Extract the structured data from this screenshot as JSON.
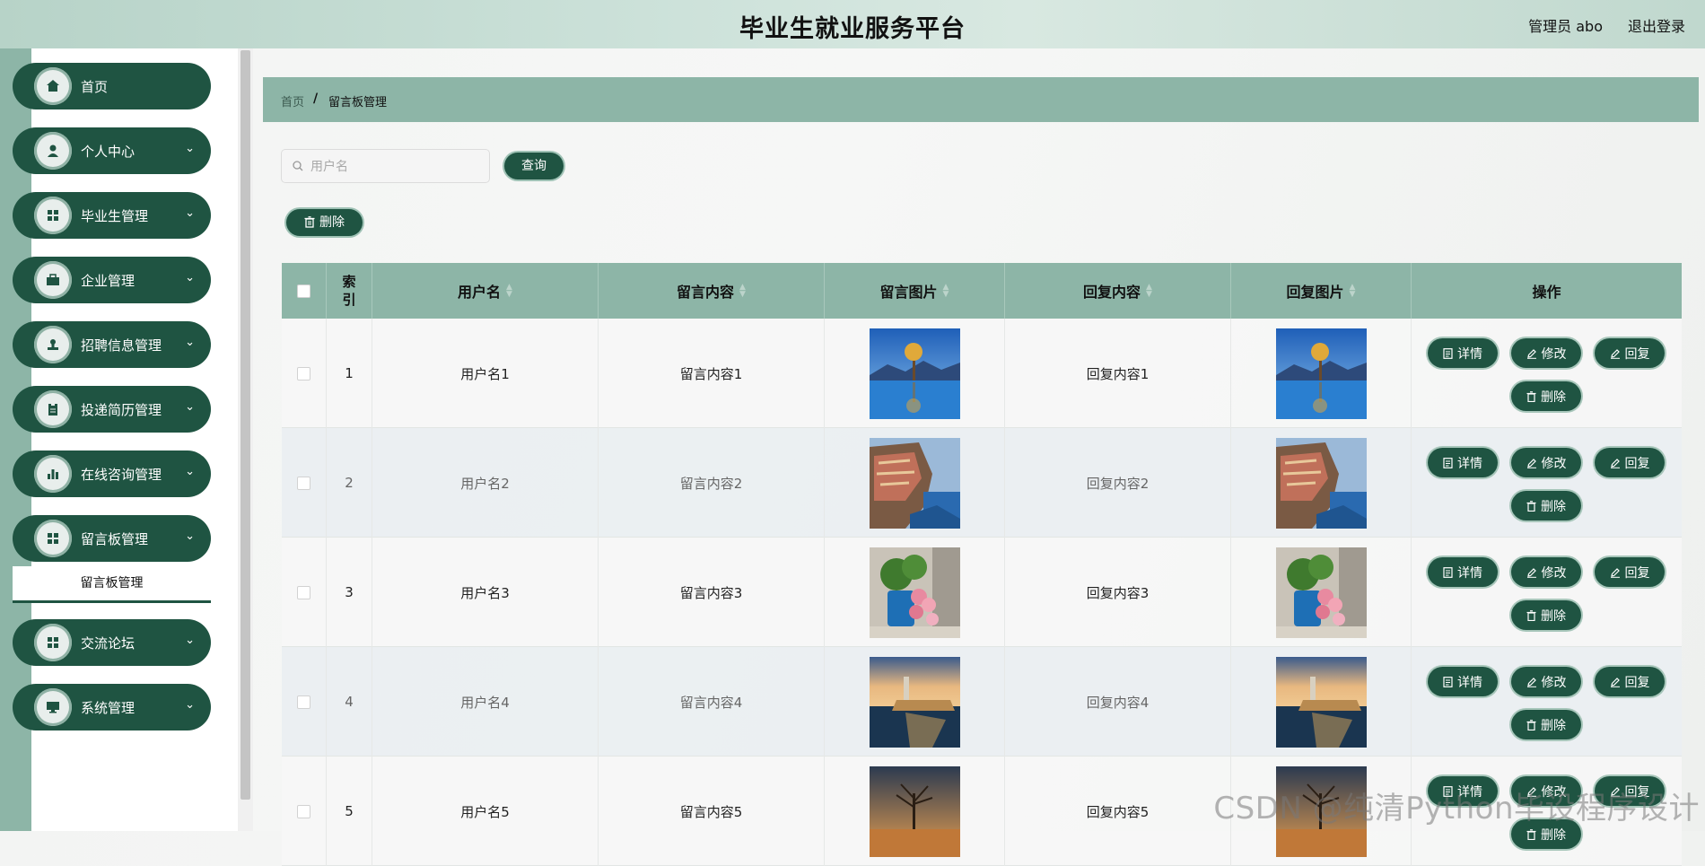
{
  "header": {
    "title": "毕业生就业服务平台",
    "user": "管理员 abo",
    "logout": "退出登录"
  },
  "sidebar": {
    "items": [
      {
        "label": "首页",
        "icon": "home-icon",
        "chevron": false
      },
      {
        "label": "个人中心",
        "icon": "person-icon",
        "chevron": true
      },
      {
        "label": "毕业生管理",
        "icon": "grid-icon",
        "chevron": true
      },
      {
        "label": "企业管理",
        "icon": "briefcase-icon",
        "chevron": true
      },
      {
        "label": "招聘信息管理",
        "icon": "stamp-icon",
        "chevron": true
      },
      {
        "label": "投递简历管理",
        "icon": "clipboard-icon",
        "chevron": true
      },
      {
        "label": "在线咨询管理",
        "icon": "bar-chart-icon",
        "chevron": true
      },
      {
        "label": "留言板管理",
        "icon": "grid-icon",
        "chevron": true
      },
      {
        "label": "交流论坛",
        "icon": "grid-icon",
        "chevron": true
      },
      {
        "label": "系统管理",
        "icon": "monitor-icon",
        "chevron": true
      }
    ],
    "sub_item": "留言板管理"
  },
  "breadcrumb": {
    "home": "首页",
    "separator": "/",
    "current": "留言板管理"
  },
  "search": {
    "placeholder": "用户名",
    "value": "",
    "button": "查询"
  },
  "toolbar": {
    "delete_label": "删除"
  },
  "table": {
    "columns": [
      "索引",
      "用户名",
      "留言内容",
      "留言图片",
      "回复内容",
      "回复图片",
      "操作"
    ],
    "rows": [
      {
        "index": "1",
        "username": "用户名1",
        "content": "留言内容1",
        "image": "lake-tree",
        "reply": "回复内容1",
        "reply_image": "lake-tree"
      },
      {
        "index": "2",
        "username": "用户名2",
        "content": "留言内容2",
        "image": "cliff-village",
        "reply": "回复内容2",
        "reply_image": "cliff-village"
      },
      {
        "index": "3",
        "username": "用户名3",
        "content": "留言内容3",
        "image": "flower-pot",
        "reply": "回复内容3",
        "reply_image": "flower-pot"
      },
      {
        "index": "4",
        "username": "用户名4",
        "content": "留言内容4",
        "image": "castle-lake",
        "reply": "回复内容4",
        "reply_image": "castle-lake"
      },
      {
        "index": "5",
        "username": "用户名5",
        "content": "留言内容5",
        "image": "sunset-tree",
        "reply": "回复内容5",
        "reply_image": "sunset-tree"
      }
    ],
    "actions": {
      "detail": "详情",
      "edit": "修改",
      "reply": "回复",
      "delete": "删除"
    }
  },
  "watermark": "CSDN @纯清Python毕设程序设计",
  "colors": {
    "primary": "#1f5442",
    "accent": "#8db5a7",
    "header": "#c6ddd4"
  }
}
